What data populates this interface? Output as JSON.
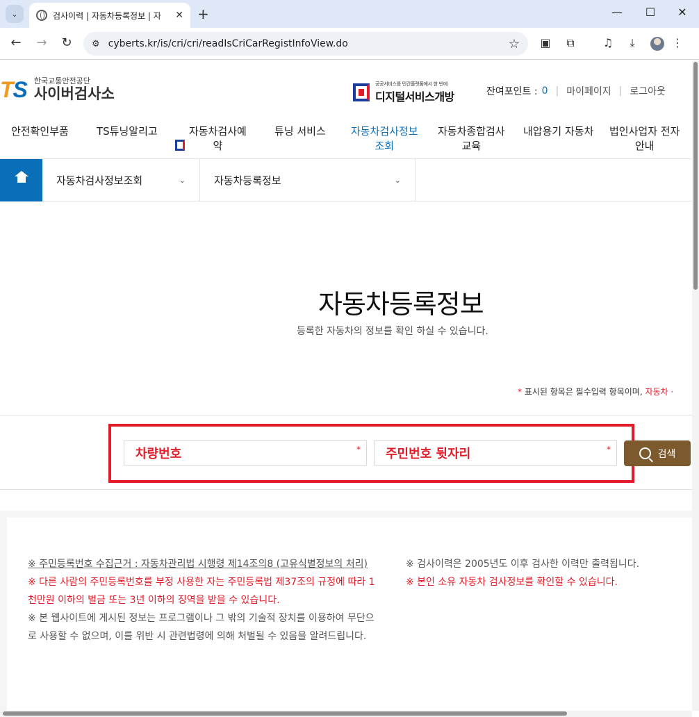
{
  "browser": {
    "tab_title": "검사이력 | 자동차등록정보 | 자",
    "url": "cyberts.kr/is/cri/cri/readIsCriCarRegistInfoView.do"
  },
  "header": {
    "org_small": "한국교통안전공단",
    "site_name": "사이버검사소",
    "digital_small": "공공서비스를 민간플랫폼에서 한 번에",
    "digital_big": "디지털서비스개방",
    "points_label": "잔여포인트 :",
    "points_value": "0",
    "mypage": "마이페이지",
    "logout": "로그아웃"
  },
  "gnb": [
    "안전확인부품",
    "TS튜닝알리고",
    "자동차검사예\n약",
    "튜닝 서비스",
    "자동차검사정보\n조회",
    "자동차종합검사\n교육",
    "내압용기 자동차",
    "법인사업자 전자\n안내"
  ],
  "breadcrumb": {
    "level1": "자동차검사정보조회",
    "level2": "자동차등록정보"
  },
  "main": {
    "title": "자동차등록정보",
    "subtitle": "등록한 자동차의 정보를 확인 하실 수 있습니다.",
    "required_star": "*",
    "required_text": " 표시된 항목은 필수입력 항목이며, ",
    "required_tail": "자동차 ·"
  },
  "search": {
    "car_number_placeholder": "차량번호",
    "resident_placeholder": "주민번호 뒷자리",
    "asterisk": "*",
    "button_label": "검색"
  },
  "notice": {
    "left_1": "※ 주민등록번호 수집근거 : 자동차관리법 시행령 제14조의8 (고유식별정보의 처리)",
    "left_2": "※ 다른 사람의 주민등록번호를 부정 사용한 자는 주민등록법 제37조의 규정에 따라 1천만원 이하의 벌금 또는 3년 이하의 징역을 받을 수 있습니다.",
    "left_3": "※ 본 웹사이트에 게시된 정보는 프로그램이나 그 밖의 기술적 장치를 이용하여 무단으로 사용할 수 없으며, 이를 위반 시 관련법령에 의해 처벌될 수 있음을 알려드립니다.",
    "right_1": "※ 검사이력은 2005년도 이후 검사한 이력만 출력됩니다.",
    "right_2": "※ 본인 소유 자동차 검사정보를 확인할 수 있습니다."
  }
}
